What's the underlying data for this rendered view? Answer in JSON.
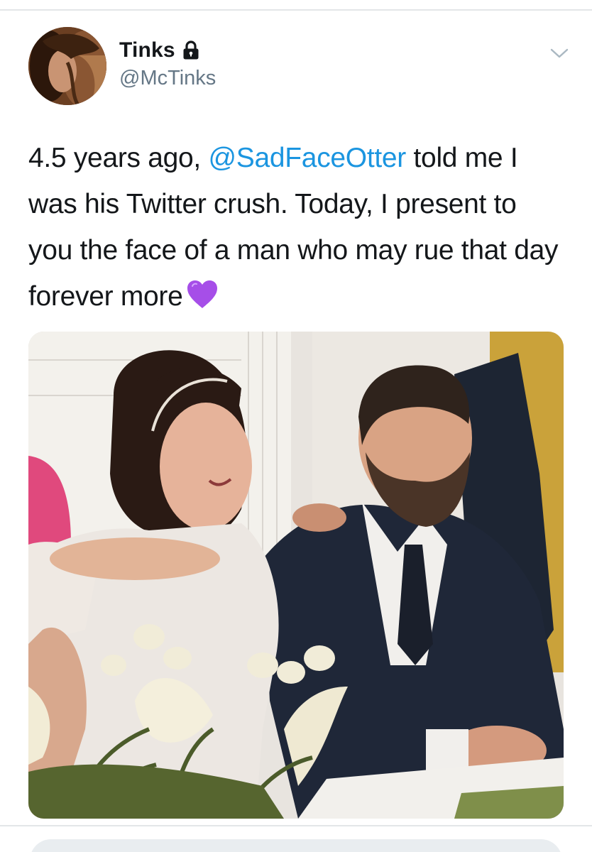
{
  "tweet": {
    "author": {
      "display_name": "Tinks",
      "handle": "@McTinks",
      "protected_icon": "lock-icon",
      "avatar": "avatar-photo"
    },
    "menu_icon": "chevron-down-icon",
    "text": {
      "part1": "4.5 years ago, ",
      "mention": "@SadFaceOtter",
      "part2": " told me I was his Twitter crush. Today, I present to you the face of a man who may rue that day forever more",
      "emoji": "purple-heart-icon"
    },
    "media": {
      "type": "photo"
    }
  },
  "reply_bar": {
    "placeholder": ""
  },
  "colors": {
    "text": "#14171a",
    "secondary_text": "#657786",
    "link": "#1b95e0",
    "divider": "#e3e6e8",
    "heart": "#a64ee8"
  }
}
